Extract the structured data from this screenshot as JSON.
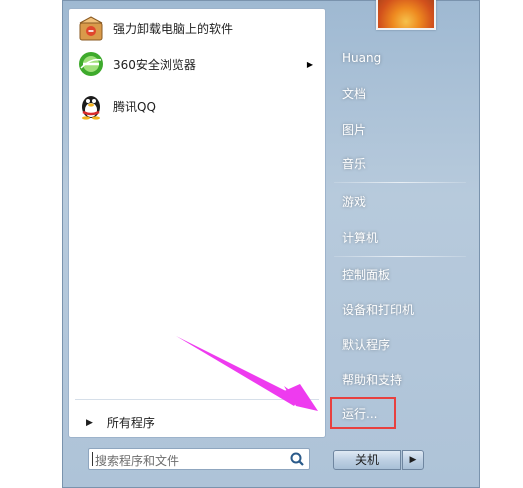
{
  "left_panel": {
    "programs": [
      {
        "label": "强力卸载电脑上的软件",
        "icon": "uninstaller-box-icon"
      },
      {
        "label": "360安全浏览器",
        "icon": "360-browser-icon",
        "has_submenu": true
      },
      {
        "label": "腾讯QQ",
        "icon": "qq-penguin-icon"
      }
    ],
    "all_programs": "所有程序"
  },
  "search": {
    "placeholder": "搜索程序和文件"
  },
  "right_panel": {
    "items": [
      "Huang",
      "文档",
      "图片",
      "音乐",
      "游戏",
      "计算机",
      "控制面板",
      "设备和打印机",
      "默认程序",
      "帮助和支持",
      "运行..."
    ]
  },
  "shutdown": {
    "label": "关机"
  },
  "annotation": {
    "highlight_color": "#e8403f",
    "arrow_color": "#ee3bef"
  }
}
